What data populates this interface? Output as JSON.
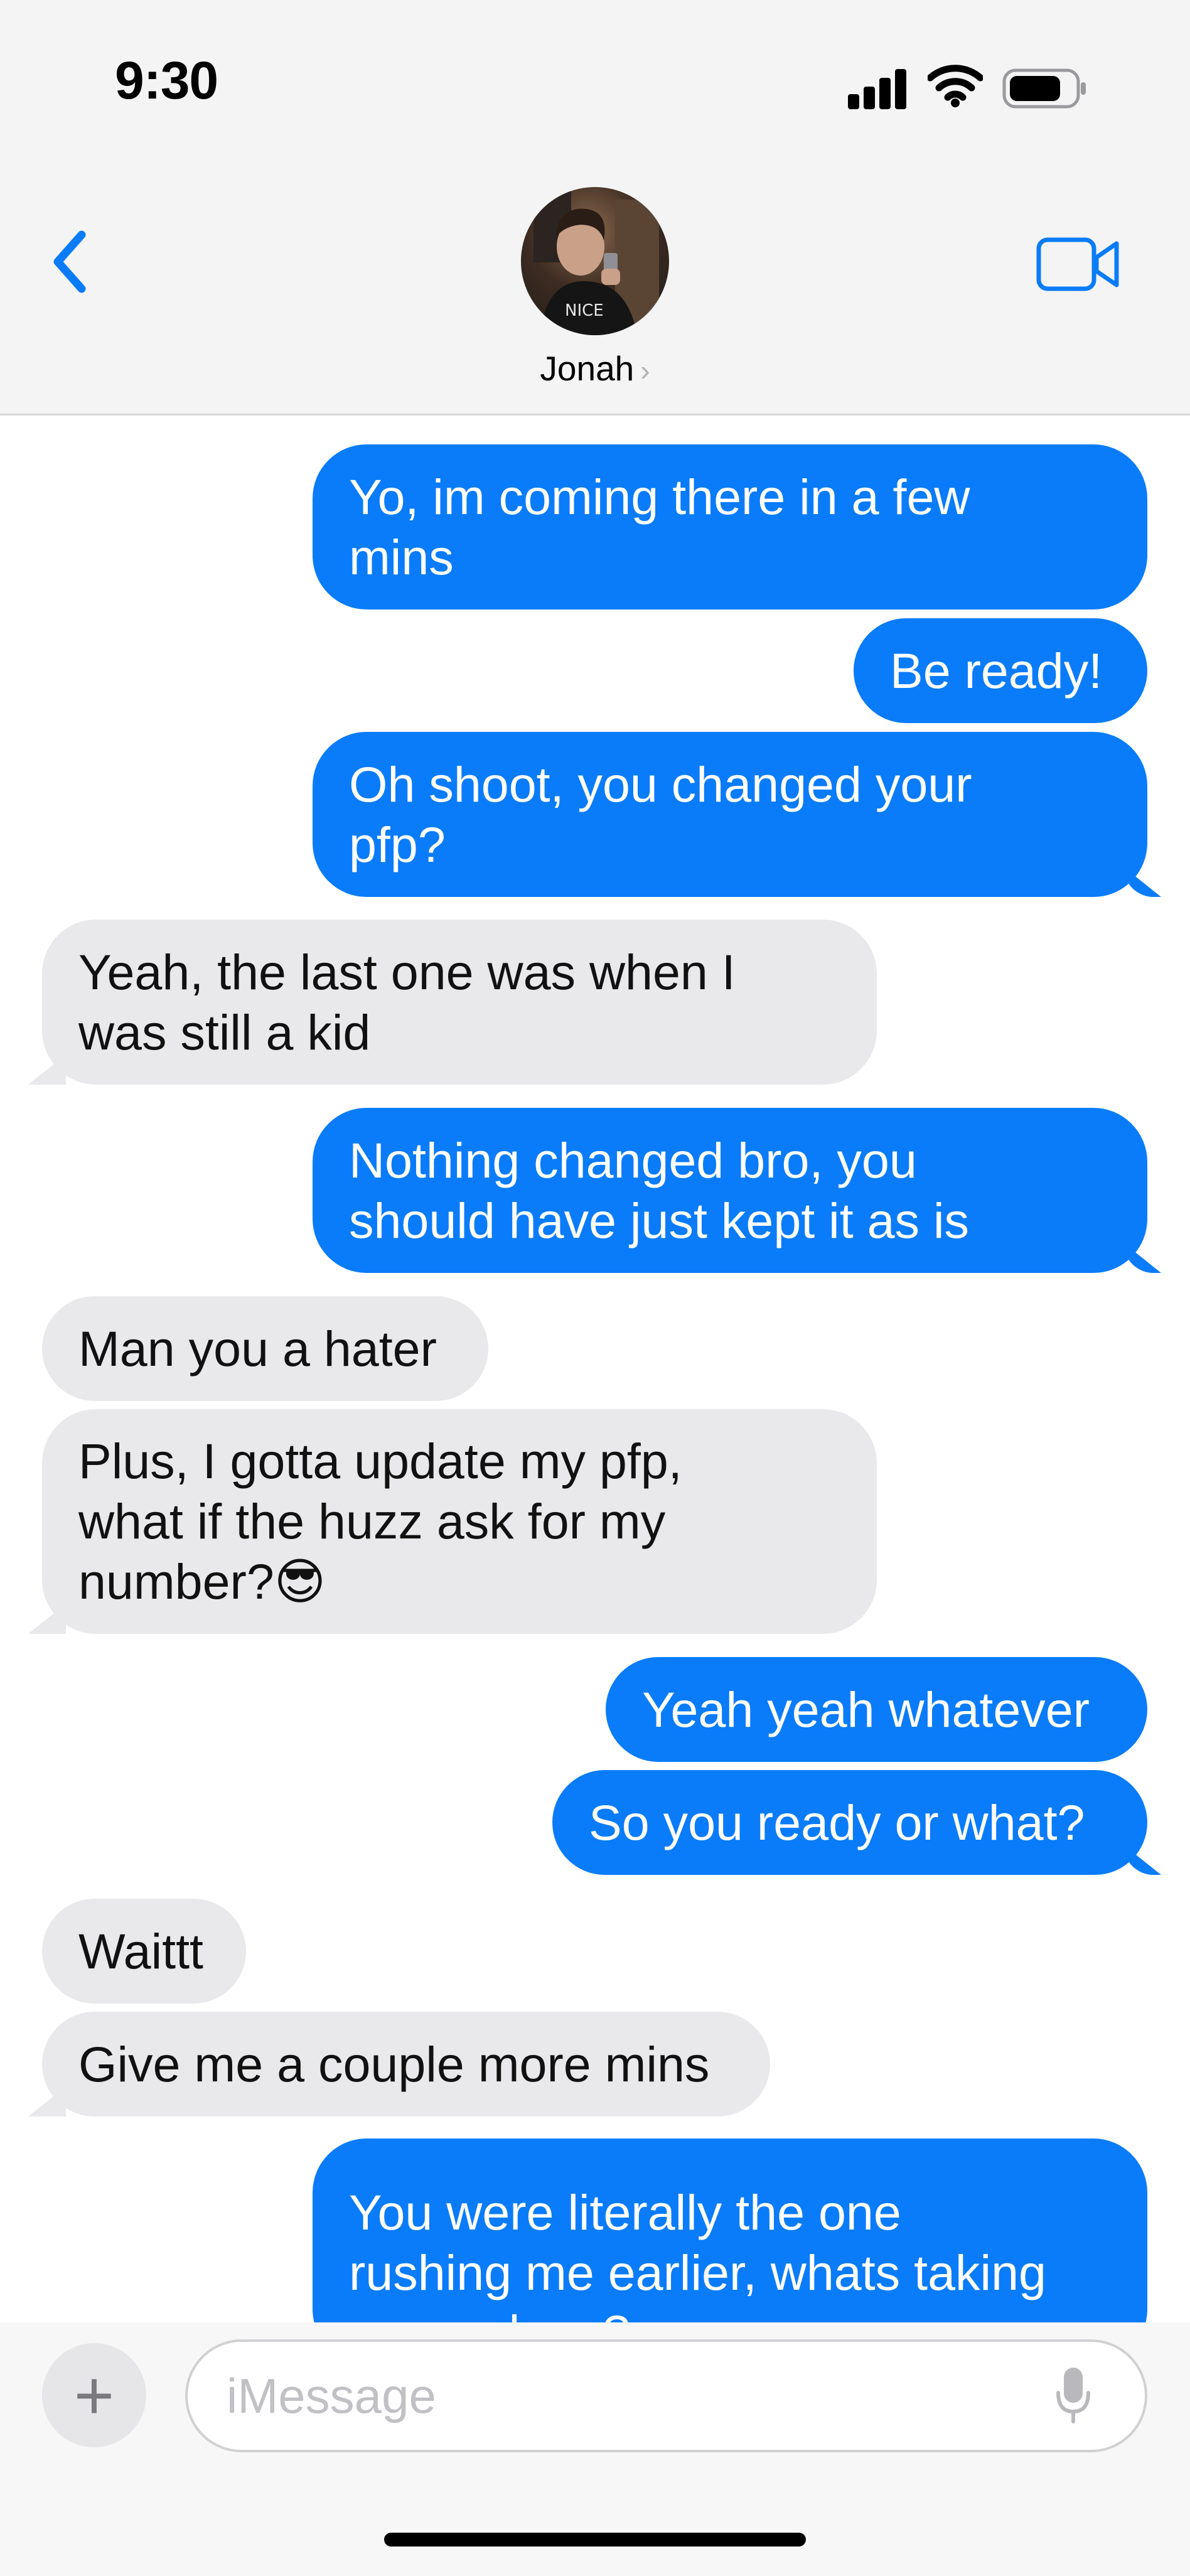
{
  "status_bar": {
    "time": "9:30"
  },
  "header": {
    "contact_name": "Jonah",
    "name_chevron": "›"
  },
  "messages": [
    {
      "from": "me",
      "text": " Yo, im coming there in a few\nmins"
    },
    {
      "from": "me",
      "text": "Be ready!"
    },
    {
      "from": "me",
      "text": "Oh shoot, you changed your\npfp?"
    },
    {
      "from": "them",
      "text": "Yeah, the last one was when I\nwas still a kid"
    },
    {
      "from": "me",
      "text": "Nothing changed bro, you\nshould have just kept it as is"
    },
    {
      "from": "them",
      "text": "Man you a hater"
    },
    {
      "from": "them",
      "text": "Plus, I gotta update my pfp,\nwhat if the huzz ask for my\nnumber?😎"
    },
    {
      "from": "me",
      "text": "Yeah yeah whatever"
    },
    {
      "from": "me",
      "text": "So you ready or what?"
    },
    {
      "from": "them",
      "text": "Waittt"
    },
    {
      "from": "them",
      "text": "Give me a couple more mins"
    },
    {
      "from": "me",
      "text": "You were literally the one\nrushing me earlier, whats taking\nyou so long?"
    }
  ],
  "composer": {
    "plus_label": "+",
    "placeholder": "iMessage"
  },
  "colors": {
    "outgoing_bubble": "#0a7cf9",
    "incoming_bubble": "#e9e9eb",
    "accent": "#0a7cf9"
  },
  "icons": {
    "back": "chevron-left-icon",
    "video": "video-camera-icon",
    "mic": "microphone-icon",
    "signal": "cellular-signal-icon",
    "wifi": "wifi-icon",
    "battery": "battery-icon"
  }
}
